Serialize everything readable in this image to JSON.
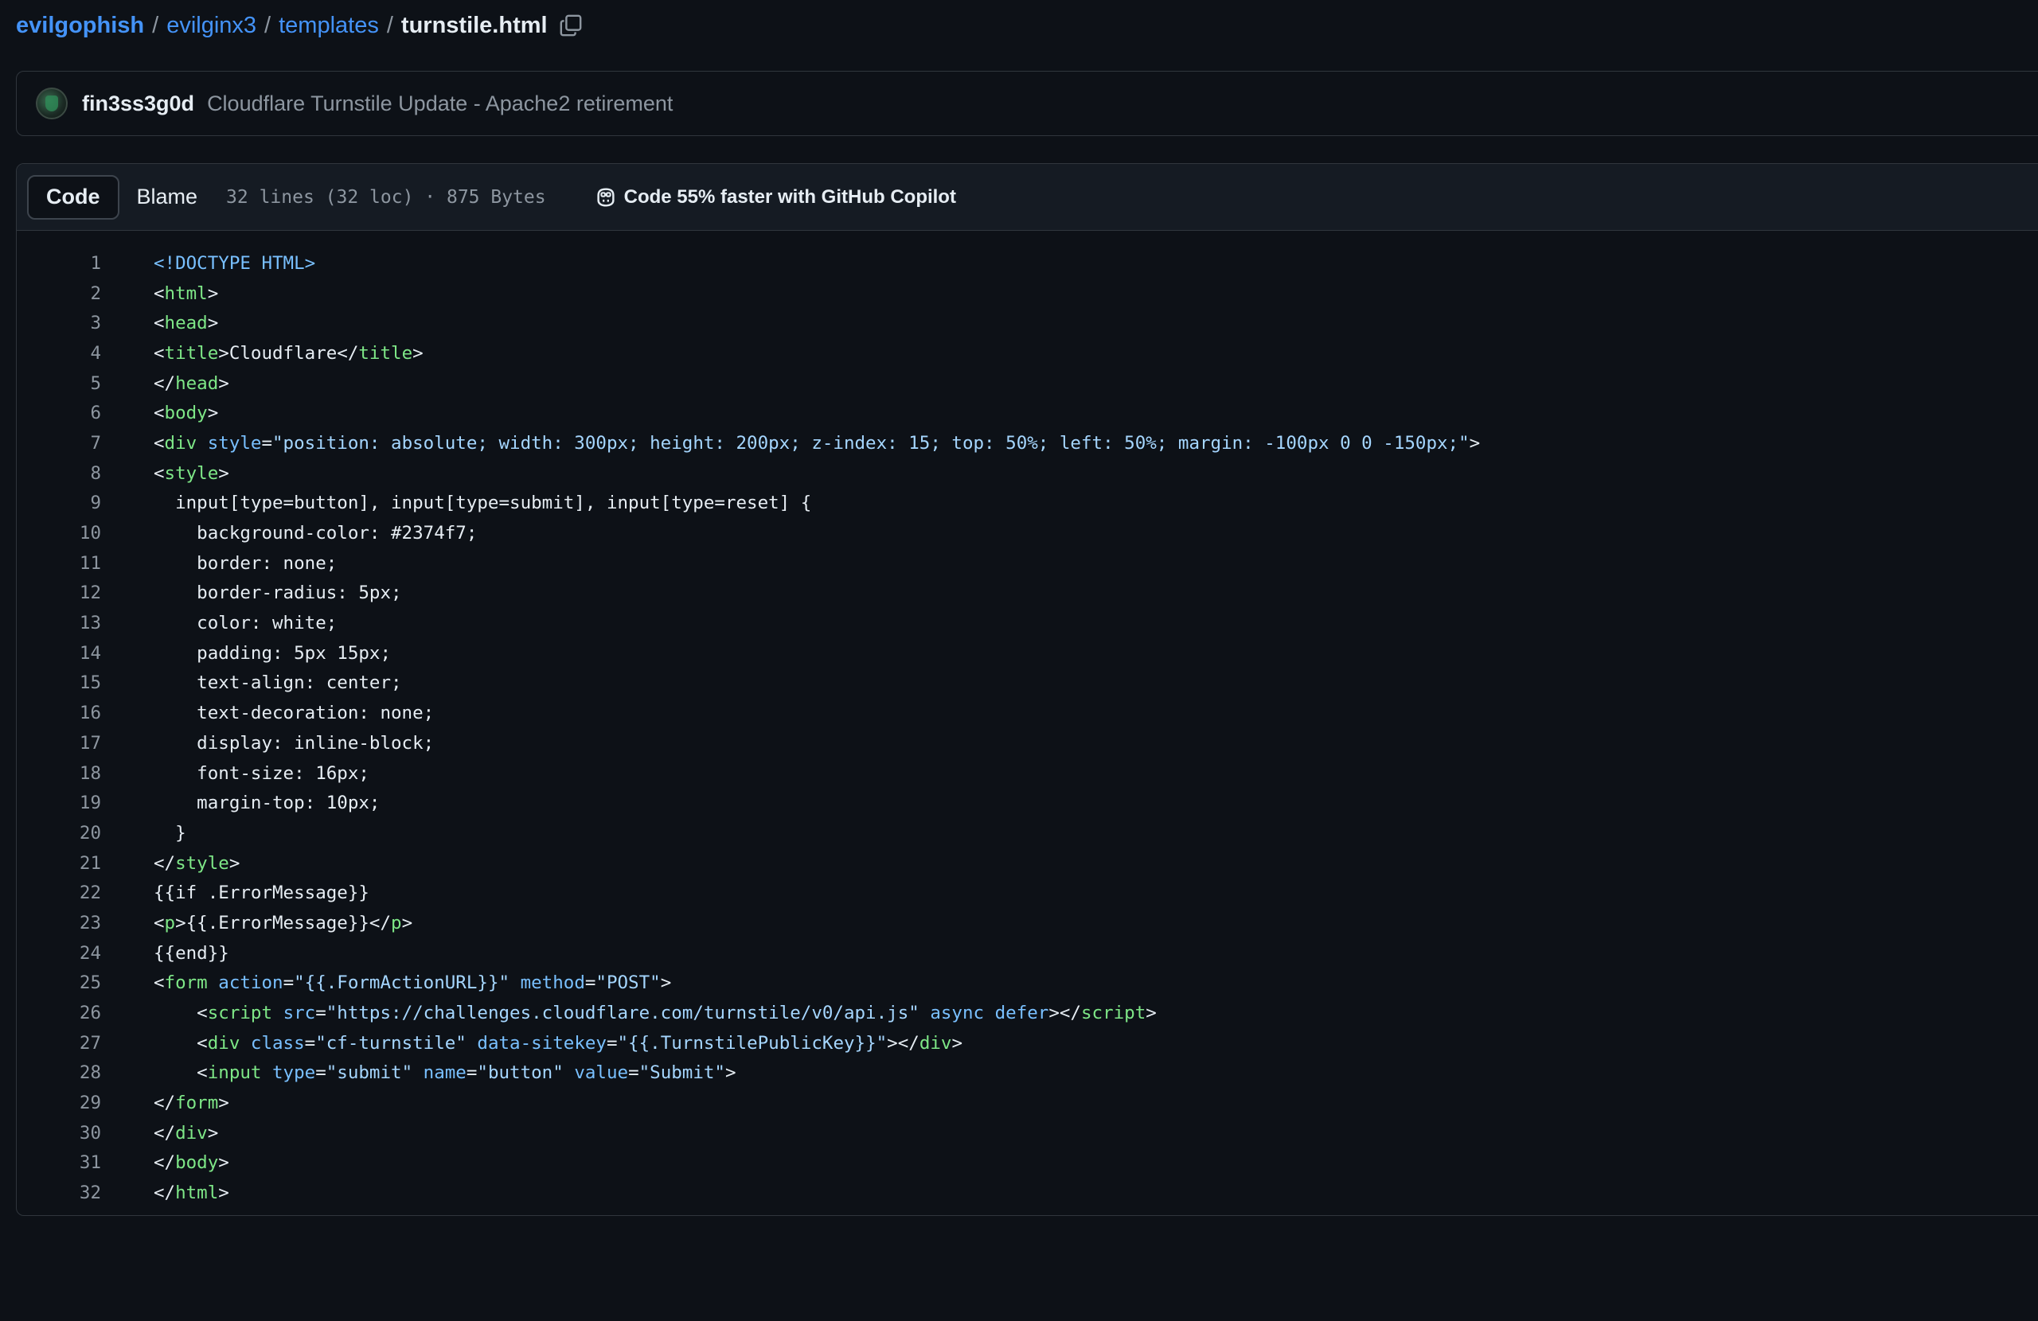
{
  "breadcrumb": {
    "owner": "evilgophish",
    "folder1": "evilginx3",
    "folder2": "templates",
    "file": "turnstile.html",
    "separator": "/"
  },
  "commit": {
    "author": "fin3ss3g0d",
    "message": "Cloudflare Turnstile Update - Apache2 retirement"
  },
  "file_header": {
    "tab_code": "Code",
    "tab_blame": "Blame",
    "meta": "32 lines (32 loc) · 875 Bytes",
    "copilot": "Code 55% faster with GitHub Copilot"
  },
  "colors": {
    "background": "#0d1117",
    "link": "#4493f8",
    "tag": "#7ee787",
    "attribute": "#79c0ff",
    "string": "#a5d6ff",
    "muted": "#8d96a0"
  },
  "icons": {
    "copy": "copy-icon",
    "copilot": "copilot-icon"
  },
  "code": [
    [
      {
        "t": "<!DOCTYPE HTML>",
        "c": "t-doctype"
      }
    ],
    [
      {
        "t": "<",
        "c": "t-plain"
      },
      {
        "t": "html",
        "c": "t-tag"
      },
      {
        "t": ">",
        "c": "t-plain"
      }
    ],
    [
      {
        "t": "<",
        "c": "t-plain"
      },
      {
        "t": "head",
        "c": "t-tag"
      },
      {
        "t": ">",
        "c": "t-plain"
      }
    ],
    [
      {
        "t": "<",
        "c": "t-plain"
      },
      {
        "t": "title",
        "c": "t-tag"
      },
      {
        "t": ">Cloudflare</",
        "c": "t-plain"
      },
      {
        "t": "title",
        "c": "t-tag"
      },
      {
        "t": ">",
        "c": "t-plain"
      }
    ],
    [
      {
        "t": "</",
        "c": "t-plain"
      },
      {
        "t": "head",
        "c": "t-tag"
      },
      {
        "t": ">",
        "c": "t-plain"
      }
    ],
    [
      {
        "t": "<",
        "c": "t-plain"
      },
      {
        "t": "body",
        "c": "t-tag"
      },
      {
        "t": ">",
        "c": "t-plain"
      }
    ],
    [
      {
        "t": "<",
        "c": "t-plain"
      },
      {
        "t": "div",
        "c": "t-tag"
      },
      {
        "t": " ",
        "c": "t-plain"
      },
      {
        "t": "style",
        "c": "t-attr"
      },
      {
        "t": "=",
        "c": "t-plain"
      },
      {
        "t": "\"position: absolute; width: 300px; height: 200px; z-index: 15; top: 50%; left: 50%; margin: -100px 0 0 -150px;\"",
        "c": "t-str"
      },
      {
        "t": ">",
        "c": "t-plain"
      }
    ],
    [
      {
        "t": "<",
        "c": "t-plain"
      },
      {
        "t": "style",
        "c": "t-tag"
      },
      {
        "t": ">",
        "c": "t-plain"
      }
    ],
    [
      {
        "t": "  input[type=button], input[type=submit], input[type=reset] {",
        "c": "t-plain"
      }
    ],
    [
      {
        "t": "    background-color: #2374f7;",
        "c": "t-plain"
      }
    ],
    [
      {
        "t": "    border: none;",
        "c": "t-plain"
      }
    ],
    [
      {
        "t": "    border-radius: 5px;",
        "c": "t-plain"
      }
    ],
    [
      {
        "t": "    color: white;",
        "c": "t-plain"
      }
    ],
    [
      {
        "t": "    padding: 5px 15px;",
        "c": "t-plain"
      }
    ],
    [
      {
        "t": "    text-align: center;",
        "c": "t-plain"
      }
    ],
    [
      {
        "t": "    text-decoration: none;",
        "c": "t-plain"
      }
    ],
    [
      {
        "t": "    display: inline-block;",
        "c": "t-plain"
      }
    ],
    [
      {
        "t": "    font-size: 16px;",
        "c": "t-plain"
      }
    ],
    [
      {
        "t": "    margin-top: 10px;",
        "c": "t-plain"
      }
    ],
    [
      {
        "t": "  }",
        "c": "t-plain"
      }
    ],
    [
      {
        "t": "</",
        "c": "t-plain"
      },
      {
        "t": "style",
        "c": "t-tag"
      },
      {
        "t": ">",
        "c": "t-plain"
      }
    ],
    [
      {
        "t": "{{if .ErrorMessage}}",
        "c": "t-plain"
      }
    ],
    [
      {
        "t": "<",
        "c": "t-plain"
      },
      {
        "t": "p",
        "c": "t-tag"
      },
      {
        "t": ">{{.ErrorMessage}}</",
        "c": "t-plain"
      },
      {
        "t": "p",
        "c": "t-tag"
      },
      {
        "t": ">",
        "c": "t-plain"
      }
    ],
    [
      {
        "t": "{{end}}",
        "c": "t-plain"
      }
    ],
    [
      {
        "t": "<",
        "c": "t-plain"
      },
      {
        "t": "form",
        "c": "t-tag"
      },
      {
        "t": " ",
        "c": "t-plain"
      },
      {
        "t": "action",
        "c": "t-attr"
      },
      {
        "t": "=",
        "c": "t-plain"
      },
      {
        "t": "\"{{.FormActionURL}}\"",
        "c": "t-str"
      },
      {
        "t": " ",
        "c": "t-plain"
      },
      {
        "t": "method",
        "c": "t-attr"
      },
      {
        "t": "=",
        "c": "t-plain"
      },
      {
        "t": "\"POST\"",
        "c": "t-str"
      },
      {
        "t": ">",
        "c": "t-plain"
      }
    ],
    [
      {
        "t": "    <",
        "c": "t-plain"
      },
      {
        "t": "script",
        "c": "t-tag"
      },
      {
        "t": " ",
        "c": "t-plain"
      },
      {
        "t": "src",
        "c": "t-attr"
      },
      {
        "t": "=",
        "c": "t-plain"
      },
      {
        "t": "\"https://challenges.cloudflare.com/turnstile/v0/api.js\"",
        "c": "t-str"
      },
      {
        "t": " ",
        "c": "t-plain"
      },
      {
        "t": "async",
        "c": "t-attr"
      },
      {
        "t": " ",
        "c": "t-plain"
      },
      {
        "t": "defer",
        "c": "t-attr"
      },
      {
        "t": "></",
        "c": "t-plain"
      },
      {
        "t": "script",
        "c": "t-tag"
      },
      {
        "t": ">",
        "c": "t-plain"
      }
    ],
    [
      {
        "t": "    <",
        "c": "t-plain"
      },
      {
        "t": "div",
        "c": "t-tag"
      },
      {
        "t": " ",
        "c": "t-plain"
      },
      {
        "t": "class",
        "c": "t-attr"
      },
      {
        "t": "=",
        "c": "t-plain"
      },
      {
        "t": "\"cf-turnstile\"",
        "c": "t-str"
      },
      {
        "t": " ",
        "c": "t-plain"
      },
      {
        "t": "data-sitekey",
        "c": "t-attr"
      },
      {
        "t": "=",
        "c": "t-plain"
      },
      {
        "t": "\"{{.TurnstilePublicKey}}\"",
        "c": "t-str"
      },
      {
        "t": "></",
        "c": "t-plain"
      },
      {
        "t": "div",
        "c": "t-tag"
      },
      {
        "t": ">",
        "c": "t-plain"
      }
    ],
    [
      {
        "t": "    <",
        "c": "t-plain"
      },
      {
        "t": "input",
        "c": "t-tag"
      },
      {
        "t": " ",
        "c": "t-plain"
      },
      {
        "t": "type",
        "c": "t-attr"
      },
      {
        "t": "=",
        "c": "t-plain"
      },
      {
        "t": "\"submit\"",
        "c": "t-str"
      },
      {
        "t": " ",
        "c": "t-plain"
      },
      {
        "t": "name",
        "c": "t-attr"
      },
      {
        "t": "=",
        "c": "t-plain"
      },
      {
        "t": "\"button\"",
        "c": "t-str"
      },
      {
        "t": " ",
        "c": "t-plain"
      },
      {
        "t": "value",
        "c": "t-attr"
      },
      {
        "t": "=",
        "c": "t-plain"
      },
      {
        "t": "\"Submit\"",
        "c": "t-str"
      },
      {
        "t": ">",
        "c": "t-plain"
      }
    ],
    [
      {
        "t": "</",
        "c": "t-plain"
      },
      {
        "t": "form",
        "c": "t-tag"
      },
      {
        "t": ">",
        "c": "t-plain"
      }
    ],
    [
      {
        "t": "</",
        "c": "t-plain"
      },
      {
        "t": "div",
        "c": "t-tag"
      },
      {
        "t": ">",
        "c": "t-plain"
      }
    ],
    [
      {
        "t": "</",
        "c": "t-plain"
      },
      {
        "t": "body",
        "c": "t-tag"
      },
      {
        "t": ">",
        "c": "t-plain"
      }
    ],
    [
      {
        "t": "</",
        "c": "t-plain"
      },
      {
        "t": "html",
        "c": "t-tag"
      },
      {
        "t": ">",
        "c": "t-plain"
      }
    ]
  ]
}
